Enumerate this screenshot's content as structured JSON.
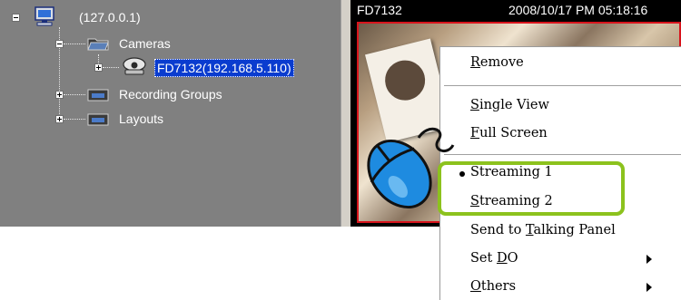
{
  "tree": {
    "root_label": "(127.0.0.1)",
    "items": [
      {
        "label": "Cameras"
      },
      {
        "label": "FD7132(192.168.5.110)"
      },
      {
        "label": "Recording Groups"
      },
      {
        "label": "Layouts"
      }
    ]
  },
  "video": {
    "camera_name": "FD7132",
    "timestamp": "2008/10/17 PM 05:18:16"
  },
  "context_menu": {
    "items": [
      {
        "label": "Remove",
        "accel": "R"
      },
      {
        "label": "Single View",
        "accel": "S"
      },
      {
        "label": "Full Screen",
        "accel": "F"
      },
      {
        "label": "Streaming 1",
        "checked": true
      },
      {
        "label": "Streaming 2",
        "accel": "S"
      },
      {
        "label": "Send to Talking Panel",
        "accel": "T"
      },
      {
        "label": "Set DO",
        "accel": "D",
        "submenu": true
      },
      {
        "label": "Others",
        "accel": "O",
        "submenu": true
      }
    ]
  },
  "colors": {
    "highlight": "#8cc21d",
    "selection": "#0a3ccf",
    "video_border": "#d8141c"
  },
  "icons": [
    "computer-icon",
    "folder-icon",
    "camera-icon",
    "mouse-icon",
    "submenu-arrow-icon",
    "bullet-icon"
  ]
}
